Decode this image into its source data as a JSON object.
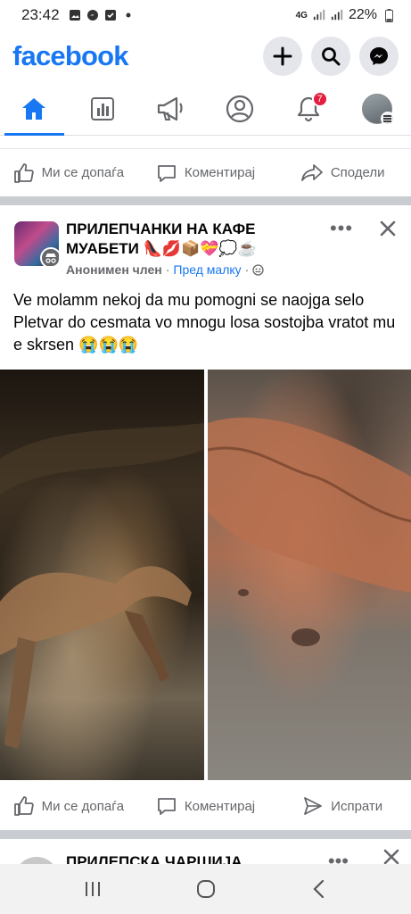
{
  "status_bar": {
    "time": "23:42",
    "network": "4G",
    "battery": "22%"
  },
  "header": {
    "logo": "facebook",
    "brand_color": "#1877f2"
  },
  "nav": {
    "notifications_badge": "7"
  },
  "actions_top": {
    "like": "Ми се допаѓа",
    "comment": "Коментирај",
    "share": "Сподели"
  },
  "post": {
    "group_name": "ПРИЛЕПЧАНКИ НА КАФЕ МУАБЕТИ 👠💋📦💝💭☕",
    "author": "Анонимен член",
    "separator": "·",
    "time": "Пред малку",
    "text": "Ve molamm nekoj da mu pomogni se naojga selo Pletvar do cesmata vo mnogu losa sostojba vratot mu e skrsen 😭😭😭",
    "menu": "•••"
  },
  "actions_bottom": {
    "like": "Ми се допаѓа",
    "comment": "Коментирај",
    "send": "Испрати"
  },
  "next_post": {
    "group_name": "ПРИЛЕПСКА ЧАРШИЈА",
    "menu": "•••"
  }
}
